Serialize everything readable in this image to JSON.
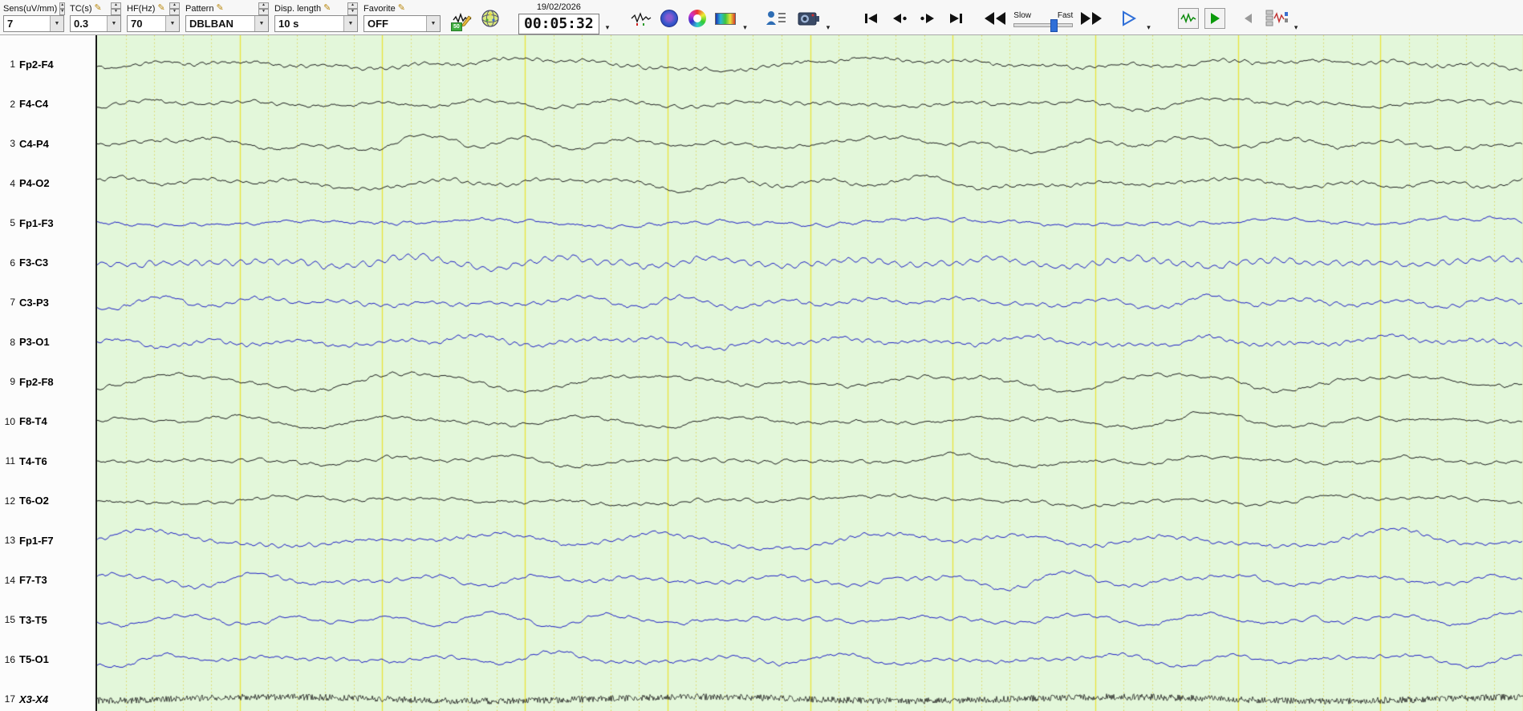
{
  "toolbar": {
    "sens_label": "Sens(uV/mm)",
    "sens_value": "7",
    "tc_label": "TC(s)",
    "tc_value": "0.3",
    "hf_label": "HF(Hz)",
    "hf_value": "70",
    "pattern_label": "Pattern",
    "pattern_value": "DBLBAN",
    "disp_label": "Disp. length",
    "disp_value": "10 s",
    "fav_label": "Favorite",
    "fav_value": "OFF",
    "date": "19/02/2026",
    "time": "00:05:32",
    "slow": "Slow",
    "fast": "Fast",
    "badge_50": "50"
  },
  "icons": {
    "pencil": "✎",
    "up": "▲",
    "down": "▼",
    "caret": "▾"
  },
  "display": {
    "seconds": 10,
    "bg": "#e3f7da",
    "grid_major": "#e9e23c",
    "grid_minor": "#ddd45e",
    "trace_black": "#1d1d1d",
    "trace_blue": "#1d1dc4"
  },
  "channels": [
    {
      "num": 1,
      "label": "Fp2-F4",
      "color": "black",
      "style": "eeg",
      "amp": 1.0,
      "act": 1.0
    },
    {
      "num": 2,
      "label": "F4-C4",
      "color": "black",
      "style": "eeg",
      "amp": 1.1,
      "act": 1.0
    },
    {
      "num": 3,
      "label": "C4-P4",
      "color": "black",
      "style": "eeg",
      "amp": 1.0,
      "act": 1.1
    },
    {
      "num": 4,
      "label": "P4-O2",
      "color": "black",
      "style": "eeg",
      "amp": 1.3,
      "act": 1.0
    },
    {
      "num": 5,
      "label": "Fp1-F3",
      "color": "blue",
      "style": "eeg",
      "amp": 0.9,
      "act": 1.2
    },
    {
      "num": 6,
      "label": "F3-C3",
      "color": "blue",
      "style": "eeg",
      "amp": 0.8,
      "act": 2.6
    },
    {
      "num": 7,
      "label": "C3-P3",
      "color": "blue",
      "style": "eeg",
      "amp": 0.9,
      "act": 1.4
    },
    {
      "num": 8,
      "label": "P3-O1",
      "color": "blue",
      "style": "eeg",
      "amp": 1.0,
      "act": 1.3
    },
    {
      "num": 9,
      "label": "Fp2-F8",
      "color": "black",
      "style": "eeg",
      "amp": 1.2,
      "act": 1.1
    },
    {
      "num": 10,
      "label": "F8-T4",
      "color": "black",
      "style": "eeg",
      "amp": 0.9,
      "act": 1.0
    },
    {
      "num": 11,
      "label": "T4-T6",
      "color": "black",
      "style": "eeg",
      "amp": 1.0,
      "act": 1.0
    },
    {
      "num": 12,
      "label": "T6-O2",
      "color": "black",
      "style": "eeg",
      "amp": 0.9,
      "act": 1.0
    },
    {
      "num": 13,
      "label": "Fp1-F7",
      "color": "blue",
      "style": "eeg",
      "amp": 1.4,
      "act": 1.1
    },
    {
      "num": 14,
      "label": "F7-T3",
      "color": "blue",
      "style": "eeg",
      "amp": 1.1,
      "act": 1.2
    },
    {
      "num": 15,
      "label": "T3-T5",
      "color": "blue",
      "style": "eeg",
      "amp": 1.0,
      "act": 1.2
    },
    {
      "num": 16,
      "label": "T5-O1",
      "color": "blue",
      "style": "eeg",
      "amp": 0.9,
      "act": 1.0
    },
    {
      "num": 17,
      "label": "X3-X4",
      "color": "black",
      "style": "emg",
      "italic": true
    }
  ]
}
